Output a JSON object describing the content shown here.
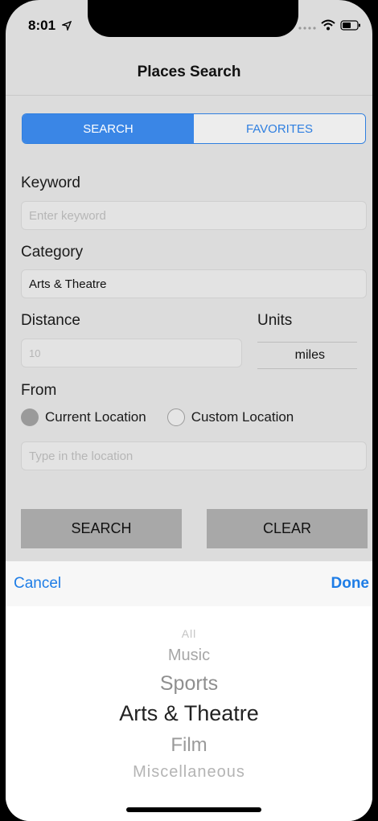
{
  "status": {
    "time": "8:01"
  },
  "nav": {
    "title": "Places Search"
  },
  "tabs": [
    {
      "label": "SEARCH",
      "active": true
    },
    {
      "label": "FAVORITES",
      "active": false
    }
  ],
  "form": {
    "keyword_label": "Keyword",
    "keyword_placeholder": "Enter keyword",
    "category_label": "Category",
    "category_value": "Arts & Theatre",
    "distance_label": "Distance",
    "distance_placeholder": "10",
    "units_label": "Units",
    "units_value": "miles",
    "from_label": "From",
    "current_location": "Current Location",
    "custom_location": "Custom Location",
    "location_placeholder": "Type in the location"
  },
  "buttons": {
    "search": "SEARCH",
    "clear": "CLEAR"
  },
  "toolbar": {
    "cancel": "Cancel",
    "done": "Done"
  },
  "picker": {
    "options": [
      "All",
      "Music",
      "Sports",
      "Arts & Theatre",
      "Film",
      "Miscellaneous"
    ],
    "selected": "Arts & Theatre"
  },
  "colors": {
    "accent": "#1e7de6",
    "segment_active": "#3a86e6",
    "button_bg": "#a8a8a8"
  }
}
